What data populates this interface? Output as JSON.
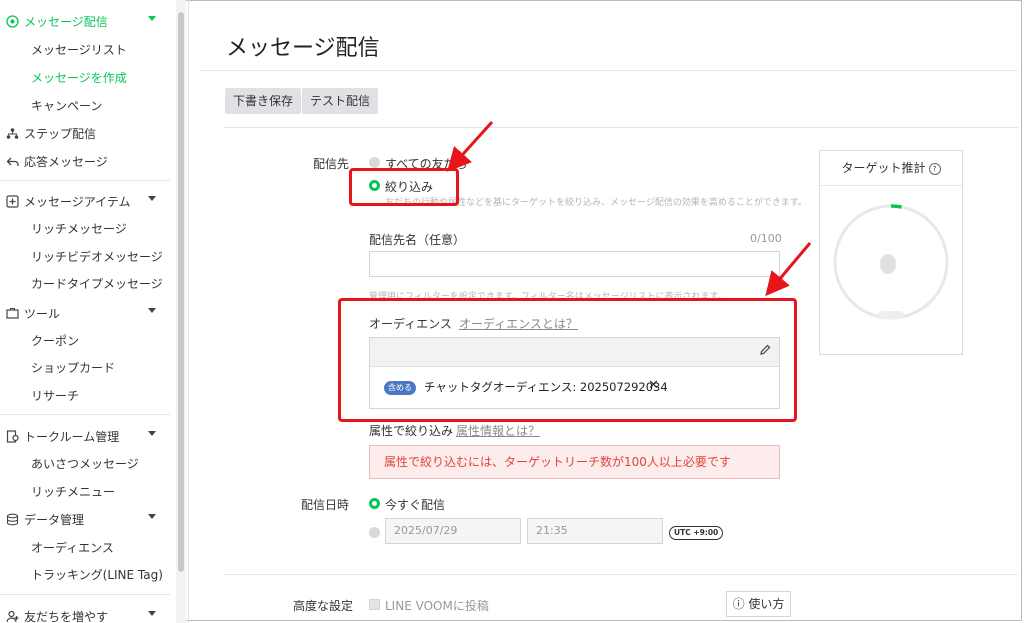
{
  "sidebar": {
    "groups": [
      {
        "label": "メッセージ配信",
        "icon": "broadcast-icon",
        "items": [
          "メッセージリスト",
          "メッセージを作成",
          "キャンペーン"
        ]
      },
      {
        "label": "ステップ配信",
        "icon": "step-icon"
      },
      {
        "label": "応答メッセージ",
        "icon": "reply-icon"
      },
      {
        "label": "メッセージアイテム",
        "icon": "message-item-icon",
        "items": [
          "リッチメッセージ",
          "リッチビデオメッセージ",
          "カードタイプメッセージ"
        ]
      },
      {
        "label": "ツール",
        "icon": "tool-icon",
        "items": [
          "クーポン",
          "ショップカード",
          "リサーチ"
        ]
      },
      {
        "label": "トークルーム管理",
        "icon": "talkroom-icon",
        "items": [
          "あいさつメッセージ",
          "リッチメニュー"
        ]
      },
      {
        "label": "データ管理",
        "icon": "database-icon",
        "items": [
          "オーディエンス",
          "トラッキング(LINE Tag)"
        ]
      },
      {
        "label": "友だちを増やす",
        "icon": "add-friend-icon"
      }
    ]
  },
  "main": {
    "title": "メッセージ配信",
    "buttons": {
      "save_draft": "下書き保存",
      "test_send": "テスト配信"
    },
    "destination": {
      "label": "配信先",
      "option_all": "すべての友だち",
      "option_filter": "絞り込み",
      "filter_help": "友だちの行動や属性などを基にターゲットを絞り込み、メッセージ配信の効果を高めることができます。",
      "name_label": "配信先名（任意）",
      "name_count": "0/100",
      "name_help": "管理用にフィルターを設定できます。フィルター名はメッセージリストに表示されます。",
      "audience_label": "オーディエンス",
      "audience_link": "オーディエンスとは？",
      "audience_tag": "含める",
      "audience_name": "チャットタグオーディエンス: 202507292034",
      "remove": "✕",
      "attr_label": "属性で絞り込み",
      "attr_link": "属性情報とは？",
      "alert": "属性で絞り込むには、ターゲットリーチ数が100人以上必要です"
    },
    "schedule": {
      "label": "配信日時",
      "now": "今すぐ配信",
      "date": "2025/07/29",
      "time": "21:35",
      "tz": "UTC +9:00"
    },
    "advanced": {
      "label": "高度な設定",
      "voom": "LINE VOOMに投稿",
      "howto": "使い方"
    }
  },
  "target": {
    "title": "ターゲット推計",
    "help": "?",
    "gauge_fill": 0.03
  },
  "colors": {
    "accent": "#06c755",
    "annotation": "#e8141c",
    "alert_text": "#e0443c",
    "tag": "#4a78c2"
  }
}
